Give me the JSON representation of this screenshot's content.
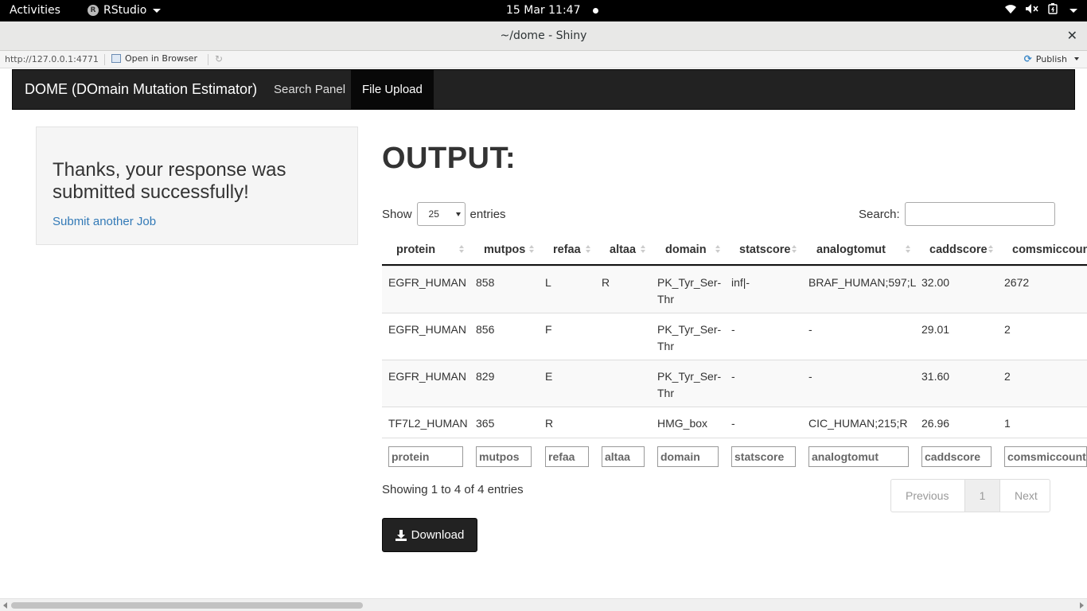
{
  "system": {
    "activities": "Activities",
    "app_name": "RStudio",
    "clock": "15 Mar  11:47"
  },
  "window": {
    "title": "~/dome - Shiny",
    "close": "✕"
  },
  "viewer": {
    "url": "http://127.0.0.1:4771",
    "open_in_browser": "Open in Browser",
    "publish": "Publish"
  },
  "navbar": {
    "brand": "DOME (DOmain Mutation Estimator)",
    "items": [
      {
        "label": "Search Panel",
        "active": false
      },
      {
        "label": "File Upload",
        "active": true
      }
    ]
  },
  "sidebar": {
    "message": "Thanks, your response was submitted successfully!",
    "link": "Submit another Job"
  },
  "output": {
    "title": "OUTPUT:",
    "show_label": "Show",
    "entries_label": "entries",
    "page_length": "25",
    "search_label": "Search:",
    "search_value": "",
    "columns": [
      "protein",
      "mutpos",
      "refaa",
      "altaa",
      "domain",
      "statscore",
      "analogtomut",
      "caddscore",
      "comsmiccount"
    ],
    "rows": [
      [
        "EGFR_HUMAN",
        "858",
        "L",
        "R",
        "PK_Tyr_Ser-Thr",
        "inf|-",
        "BRAF_HUMAN;597;L",
        "32.00",
        "2672"
      ],
      [
        "EGFR_HUMAN",
        "856",
        "F",
        "",
        "PK_Tyr_Ser-Thr",
        "-",
        "-",
        "29.01",
        "2"
      ],
      [
        "EGFR_HUMAN",
        "829",
        "E",
        "",
        "PK_Tyr_Ser-Thr",
        "-",
        "-",
        "31.60",
        "2"
      ],
      [
        "TF7L2_HUMAN",
        "365",
        "R",
        "",
        "HMG_box",
        "-",
        "CIC_HUMAN;215;R",
        "26.96",
        "1"
      ]
    ],
    "info": "Showing 1 to 4 of 4 entries",
    "pager": {
      "previous": "Previous",
      "page": "1",
      "next": "Next"
    },
    "download": "Download"
  }
}
